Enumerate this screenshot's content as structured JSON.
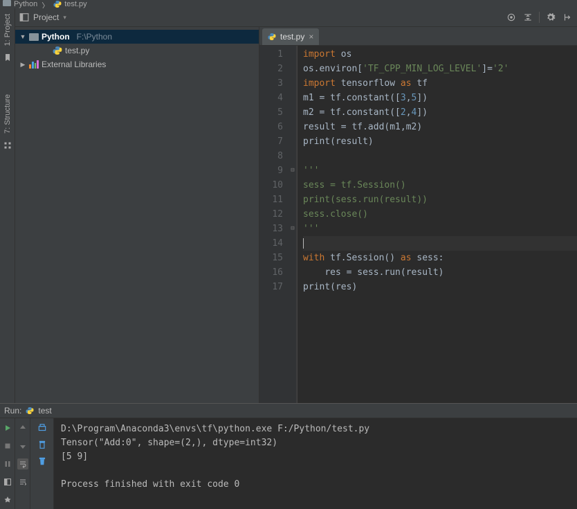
{
  "breadcrumb": {
    "root": "Python",
    "file": "test.py"
  },
  "toolstrip": {
    "project_label": "1: Project",
    "structure_label": "7: Structure"
  },
  "proj_header": {
    "label": "Project"
  },
  "tree": {
    "root": {
      "name": "Python",
      "path": "F:\\Python"
    },
    "file": {
      "name": "test.py"
    },
    "ext_libs": "External Libraries"
  },
  "tab": {
    "name": "test.py",
    "close": "×"
  },
  "code": {
    "lines": [
      {
        "n": 1,
        "pre": "",
        "t": [
          [
            "kw",
            "import"
          ],
          [
            "",
            " os"
          ]
        ]
      },
      {
        "n": 2,
        "pre": "",
        "t": [
          [
            "",
            "os.environ["
          ],
          [
            "str",
            "'TF_CPP_MIN_LOG_LEVEL'"
          ],
          [
            "",
            "]="
          ],
          [
            "str",
            "'2'"
          ]
        ]
      },
      {
        "n": 3,
        "pre": "",
        "t": [
          [
            "kw",
            "import"
          ],
          [
            "",
            " tensorflow "
          ],
          [
            "kw",
            "as"
          ],
          [
            "",
            " tf"
          ]
        ]
      },
      {
        "n": 4,
        "pre": "",
        "t": [
          [
            "",
            "m1 = tf.constant(["
          ],
          [
            "num",
            "3"
          ],
          [
            "",
            ","
          ],
          [
            "num",
            "5"
          ],
          [
            "",
            "])"
          ]
        ]
      },
      {
        "n": 5,
        "pre": "",
        "t": [
          [
            "",
            "m2 = tf.constant(["
          ],
          [
            "num",
            "2"
          ],
          [
            "",
            ","
          ],
          [
            "num",
            "4"
          ],
          [
            "",
            "])"
          ]
        ]
      },
      {
        "n": 6,
        "pre": "",
        "t": [
          [
            "",
            "result = tf.add(m1,m2)"
          ]
        ]
      },
      {
        "n": 7,
        "pre": "",
        "t": [
          [
            "fn",
            "print"
          ],
          [
            "",
            "(result)"
          ]
        ]
      },
      {
        "n": 8,
        "pre": "",
        "t": []
      },
      {
        "n": 9,
        "pre": "",
        "t": [
          [
            "str",
            "'''"
          ]
        ],
        "fold": "-"
      },
      {
        "n": 10,
        "pre": "",
        "t": [
          [
            "str",
            "sess = tf.Session()"
          ]
        ]
      },
      {
        "n": 11,
        "pre": "",
        "t": [
          [
            "str",
            "print(sess.run(result))"
          ]
        ]
      },
      {
        "n": 12,
        "pre": "",
        "t": [
          [
            "str",
            "sess.close()"
          ]
        ]
      },
      {
        "n": 13,
        "pre": "",
        "t": [
          [
            "str",
            "'''"
          ]
        ],
        "fold": "-"
      },
      {
        "n": 14,
        "pre": "",
        "t": [],
        "caret": true,
        "hl": true
      },
      {
        "n": 15,
        "pre": "",
        "t": [
          [
            "kw",
            "with"
          ],
          [
            "",
            " tf.Session() "
          ],
          [
            "kw",
            "as"
          ],
          [
            "",
            " sess:"
          ]
        ]
      },
      {
        "n": 16,
        "pre": "    ",
        "t": [
          [
            "",
            "res = sess.run(result)"
          ]
        ]
      },
      {
        "n": 17,
        "pre": "",
        "t": [
          [
            "fn",
            "print"
          ],
          [
            "",
            "(res)"
          ]
        ]
      }
    ]
  },
  "run": {
    "header_label": "Run:",
    "header_config": "test",
    "console_lines": [
      "D:\\Program\\Anaconda3\\envs\\tf\\python.exe F:/Python/test.py",
      "Tensor(\"Add:0\", shape=(2,), dtype=int32)",
      "[5 9]",
      "",
      "Process finished with exit code 0"
    ]
  }
}
